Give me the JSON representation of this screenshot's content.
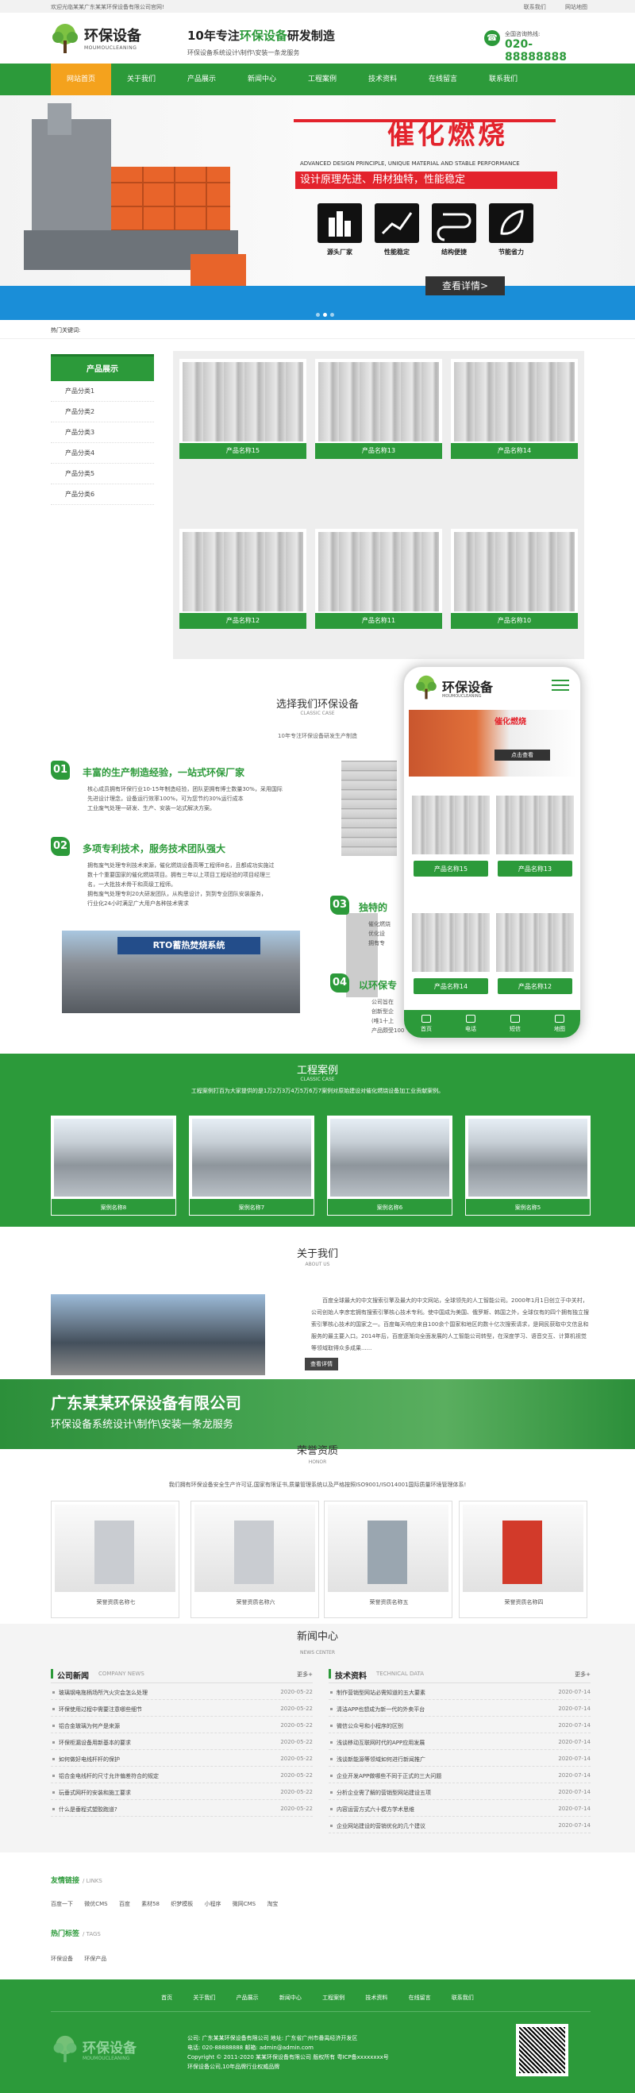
{
  "topbar": {
    "left": "欢迎光临某某广东某某环保设备有限公司官网!",
    "links": [
      "联系我们",
      "网站地图"
    ]
  },
  "header": {
    "logo_cn": "环保设备",
    "logo_en": "MOUMOUCLEANING",
    "slogan_pre": "10年专注",
    "slogan_hl": "环保设备",
    "slogan_post": "研发制造",
    "slogan_sub": "环保设备系统设计\\制作\\安装一条龙服务",
    "phone_label": "全国咨询热线:",
    "phone": "020-88888888"
  },
  "nav": [
    "网站首页",
    "关于我们",
    "产品展示",
    "新闻中心",
    "工程案例",
    "技术资料",
    "在线留言",
    "联系我们"
  ],
  "banner": {
    "title": "催化燃烧",
    "sub_en": "ADVANCED DESIGN PRINCIPLE, UNIQUE MATERIAL AND STABLE PERFORMANCE",
    "sub_cn": "设计原理先进、用材独特，性能稳定",
    "features": [
      "源头厂家",
      "性能稳定",
      "结构便捷",
      "节能省力"
    ],
    "more": "查看详情>"
  },
  "hot": "热门关键词:",
  "sidebar": {
    "title": "产品展示",
    "items": [
      "产品分类1",
      "产品分类2",
      "产品分类3",
      "产品分类4",
      "产品分类5",
      "产品分类6"
    ]
  },
  "products": [
    "产品名称15",
    "产品名称13",
    "产品名称14",
    "产品名称12",
    "产品名称11",
    "产品名称10"
  ],
  "why": {
    "title": "选择我们环保设备",
    "sub": "CLASSIC CASE",
    "desc": "10年专注环保设备研发生产制造",
    "items": [
      {
        "num": "01",
        "title": "丰富的生产制造经验，一站式环保厂家",
        "lines": [
          "核心成员拥有环保行业10-15年制造经验，团队更拥有博士数量30%，采用国际",
          "先进设计理念，设备运行效率100%，可为您节约30%运行成本",
          "工业废气处理一研发、生产、安装一站式解决方案。"
        ]
      },
      {
        "num": "02",
        "title": "多项专利技术，服务技术团队强大",
        "lines": [
          "拥有废气处理专利技术来源，催化燃烧设备高等工程师8名，且都成功实施过",
          "数十个重要国家的催化燃烧项目。拥有三年以上项目工程经验的项目经理三",
          "名，一大批技术骨干和高级工程师。",
          "拥有废气处理专利20大研发团队，从构思设计，到到专业团队安装服务，",
          "行业化24小时满足广大用户各种技术需求"
        ]
      },
      {
        "num": "03",
        "title": "独特的",
        "lines": [
          "催化燃烧",
          "优化设",
          "拥有专"
        ]
      },
      {
        "num": "04",
        "title": "以环保专",
        "lines": [
          "公司旨在",
          "创新型企",
          "(唯1十上",
          "产品颇受100"
        ]
      }
    ],
    "rto_label": "RTO蓄热焚烧系统"
  },
  "mobile": {
    "logo_cn": "环保设备",
    "logo_en": "MOUMOUCLEANING",
    "banner_title": "催化燃烧",
    "banner_btn": "点击查看",
    "products": [
      "产品名称15",
      "产品名称13",
      "产品名称14",
      "产品名称12"
    ],
    "tabs": [
      "首页",
      "电话",
      "短信",
      "地图"
    ]
  },
  "cases": {
    "title": "工程案例",
    "sub": "CLASSIC CASE",
    "desc": "工程案例打百为大家提供的是1万2万3万4万5万6万7案例对原始建设对催化燃烧设备加工业贡献案例。",
    "items": [
      "案例名称8",
      "案例名称7",
      "案例名称6",
      "案例名称5"
    ]
  },
  "about": {
    "title": "关于我们",
    "sub": "ABOUT US",
    "text": "百度全球最大的中文搜索引擎及最大的中文网站，全球领先的人工智能公司。2000年1月1日创立于中关村，公司创始人李彦宏拥有搜索引擎核心技术专利。使中国成为美国、俄罗斯、韩国之外，全球仅有的四个拥有独立搜索引擎核心技术的国家之一。百度每天响应来自100余个国家和地区的数十亿次搜索请求，是网民获取中文信息和服务的最主要入口。2014年后，百度逐渐向全面发展的人工智能公司转型，在深度学习、语音交互、计算机视觉等领域取得众多成果......",
    "btn": "查看详情"
  },
  "greenbar": {
    "company": "广东某某环保设备有限公司",
    "service": "环保设备系统设计\\制作\\安装一条龙服务"
  },
  "honor": {
    "title": "荣誉资质",
    "sub": "HONOR",
    "desc": "我们拥有环保设备安全生产许可证,国家有限证书,质量管理系统以及严格按照ISO9001/ISO14001国际质量环境管理体系!",
    "items": [
      "荣誉资质名称七",
      "荣誉资质名称六",
      "荣誉资质名称五",
      "荣誉资质名称四"
    ]
  },
  "news": {
    "title": "新闻中心",
    "sub": "NEWS CENTER",
    "left": {
      "title": "公司新闻",
      "en": "COMPANY NEWS",
      "more": "更多+",
      "rows": [
        {
          "t": "玻璃钢电拖柄场所汽火灾会怎么处理",
          "d": "2020-05-22"
        },
        {
          "t": "环保使用过程中需要注意哪些细节",
          "d": "2020-05-22"
        },
        {
          "t": "铝合金玻璃为何产是来源",
          "d": "2020-05-22"
        },
        {
          "t": "环保柜漏设备用新基本的要求",
          "d": "2020-05-22"
        },
        {
          "t": "如何做好电线杆杆的保护",
          "d": "2020-05-22"
        },
        {
          "t": "铝合金电线杆的尺寸允许偏差符合的规定",
          "d": "2020-05-22"
        },
        {
          "t": "玩垂式网杆的安装和施工要求",
          "d": "2020-05-22"
        },
        {
          "t": "什么是垂程式塑胶跑道?",
          "d": "2020-05-22"
        }
      ]
    },
    "right": {
      "title": "技术资料",
      "en": "TECHNICAL DATA",
      "more": "更多+",
      "rows": [
        {
          "t": "制作营销型网站必需知道的五大要素",
          "d": "2020-07-14"
        },
        {
          "t": "清洁APP也想成为新一代的外卖平台",
          "d": "2020-07-14"
        },
        {
          "t": "微信公众号和小程序的区别",
          "d": "2020-07-14"
        },
        {
          "t": "浅谈移动互联网时代的APP应用发展",
          "d": "2020-07-14"
        },
        {
          "t": "浅谈新能源等领域如何进行新闻推广",
          "d": "2020-07-14"
        },
        {
          "t": "企业开发APP做哪些不同于正式的三大问题",
          "d": "2020-07-14"
        },
        {
          "t": "分析企业需了解的营销型网站建设五项",
          "d": "2020-07-14"
        },
        {
          "t": "内容运营方式六十模方学术思维",
          "d": "2020-07-14"
        },
        {
          "t": "企业网站建设的营销优化的几个建议",
          "d": "2020-07-14"
        }
      ]
    }
  },
  "links": {
    "title": "友情链接",
    "en": "/ LINKS",
    "items": [
      "百度一下",
      "微优CMS",
      "百度",
      "素材58",
      "织梦模板",
      "小程序",
      "微网CMS",
      "淘宝"
    ]
  },
  "tags": {
    "title": "热门标签",
    "en": "/ TAGS",
    "items": [
      "环保设备",
      "环保产品"
    ]
  },
  "footer": {
    "nav": [
      "首页",
      "关于我们",
      "产品展示",
      "新闻中心",
      "工程案例",
      "技术资料",
      "在线留言",
      "联系我们"
    ],
    "logo_cn": "环保设备",
    "logo_en": "MOUMOUCLEANING",
    "info": [
      "公司: 广东某某环保设备有限公司 地址: 广东省广州市番禺经济开发区",
      "电话: 020-88888888 邮箱: admin@admin.com",
      "Copyright © 2011-2020 某某环保设备有限公司 版权所有 粤ICP备xxxxxxxx号",
      "环保设备公司,10年品牌行业权威品牌"
    ]
  }
}
